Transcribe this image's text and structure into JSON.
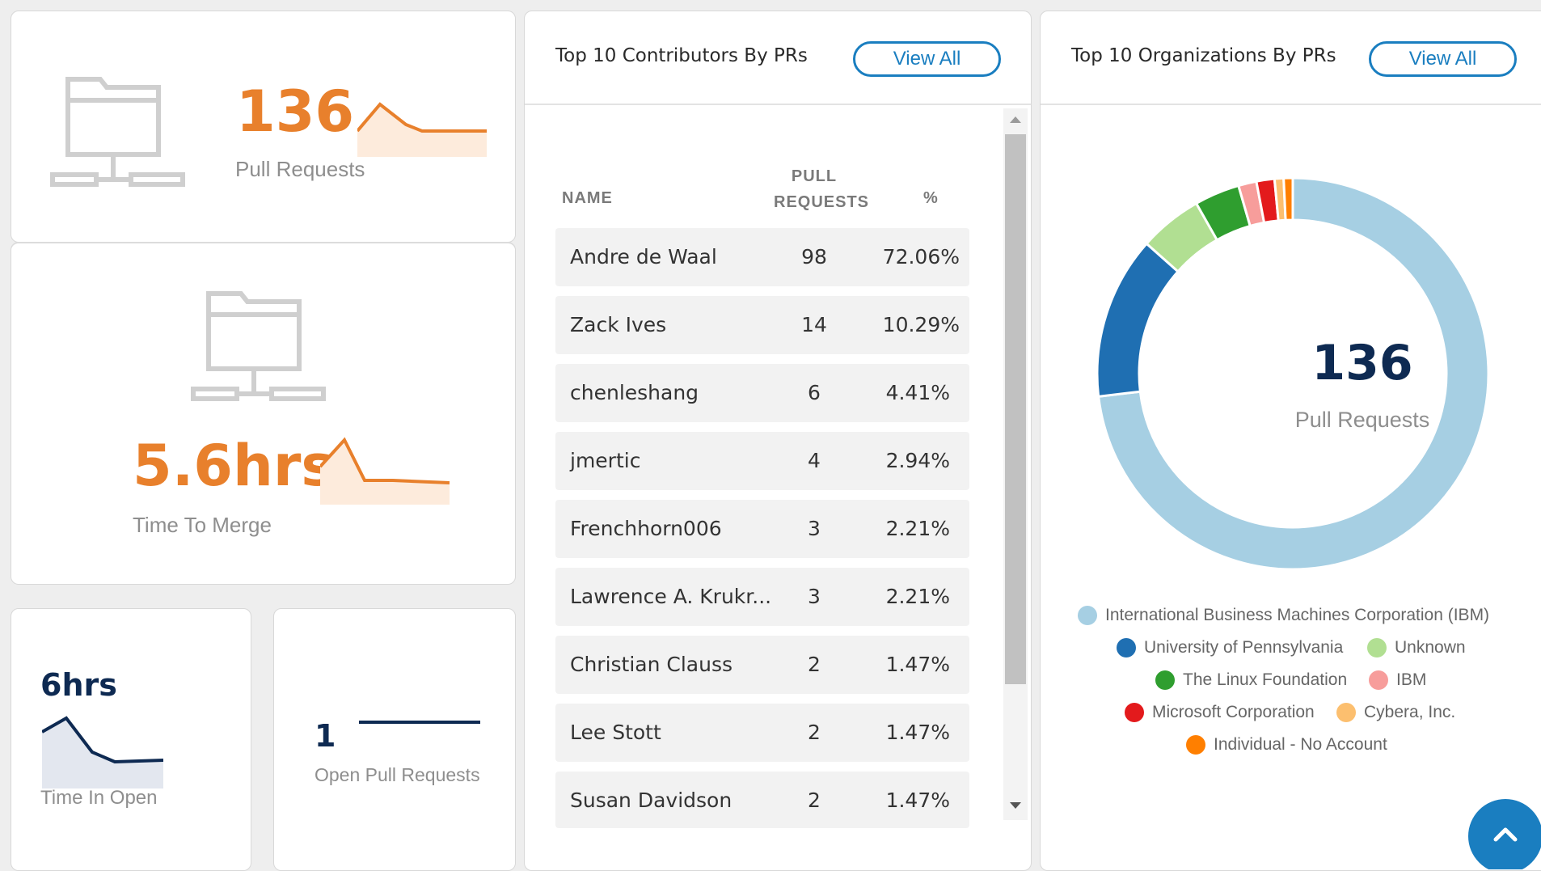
{
  "pull_requests_card": {
    "value": "136",
    "label": "Pull Requests"
  },
  "time_to_merge_card": {
    "value": "5.6hrs",
    "label": "Time To Merge"
  },
  "time_in_open_card": {
    "value": "6hrs",
    "label": "Time In Open"
  },
  "open_prs_card": {
    "value": "1",
    "label": "Open Pull Requests"
  },
  "contributors": {
    "title": "Top 10 Contributors By PRs",
    "view_all": "View All",
    "headers": {
      "name": "NAME",
      "pull_line1": "PULL",
      "pull_line2": "REQUESTS",
      "pct": "%"
    },
    "rows": [
      {
        "name": "Andre de Waal",
        "prs": "98",
        "pct": "72.06%"
      },
      {
        "name": "Zack Ives",
        "prs": "14",
        "pct": "10.29%"
      },
      {
        "name": "chenleshang",
        "prs": "6",
        "pct": "4.41%"
      },
      {
        "name": "jmertic",
        "prs": "4",
        "pct": "2.94%"
      },
      {
        "name": "Frenchhorn006",
        "prs": "3",
        "pct": "2.21%"
      },
      {
        "name": "Lawrence A. Krukr...",
        "prs": "3",
        "pct": "2.21%"
      },
      {
        "name": "Christian Clauss",
        "prs": "2",
        "pct": "1.47%"
      },
      {
        "name": "Lee Stott",
        "prs": "2",
        "pct": "1.47%"
      },
      {
        "name": "Susan Davidson",
        "prs": "2",
        "pct": "1.47%"
      }
    ]
  },
  "organizations": {
    "title": "Top 10 Organizations By PRs",
    "view_all": "View All",
    "center_value": "136",
    "center_label": "Pull Requests",
    "legend": [
      {
        "label": "International Business Machines Corporation (IBM)",
        "color": "#a6cfe3"
      },
      {
        "label": "University of Pennsylvania",
        "color": "#1f6fb2"
      },
      {
        "label": "Unknown",
        "color": "#b1df92"
      },
      {
        "label": "The Linux Foundation",
        "color": "#2f9e2f"
      },
      {
        "label": "IBM",
        "color": "#f79d9b"
      },
      {
        "label": "Microsoft Corporation",
        "color": "#e31a1c"
      },
      {
        "label": "Cybera, Inc.",
        "color": "#fcbf6f"
      },
      {
        "label": "Individual - No Account",
        "color": "#ff7f00"
      }
    ]
  },
  "chart_data": {
    "type": "pie",
    "title": "Top 10 Organizations By PRs",
    "labels": [
      "International Business Machines Corporation (IBM)",
      "University of Pennsylvania",
      "Unknown",
      "The Linux Foundation",
      "IBM",
      "Microsoft Corporation",
      "Cybera, Inc.",
      "Individual - No Account"
    ],
    "values": [
      98,
      18,
      7,
      5,
      2,
      2,
      1,
      1
    ],
    "colors": [
      "#a6cfe3",
      "#1f6fb2",
      "#b1df92",
      "#2f9e2f",
      "#f79d9b",
      "#e31a1c",
      "#fcbf6f",
      "#ff7f00"
    ],
    "total_label": "136"
  },
  "scroll_top_icon": "chevron-up-icon"
}
